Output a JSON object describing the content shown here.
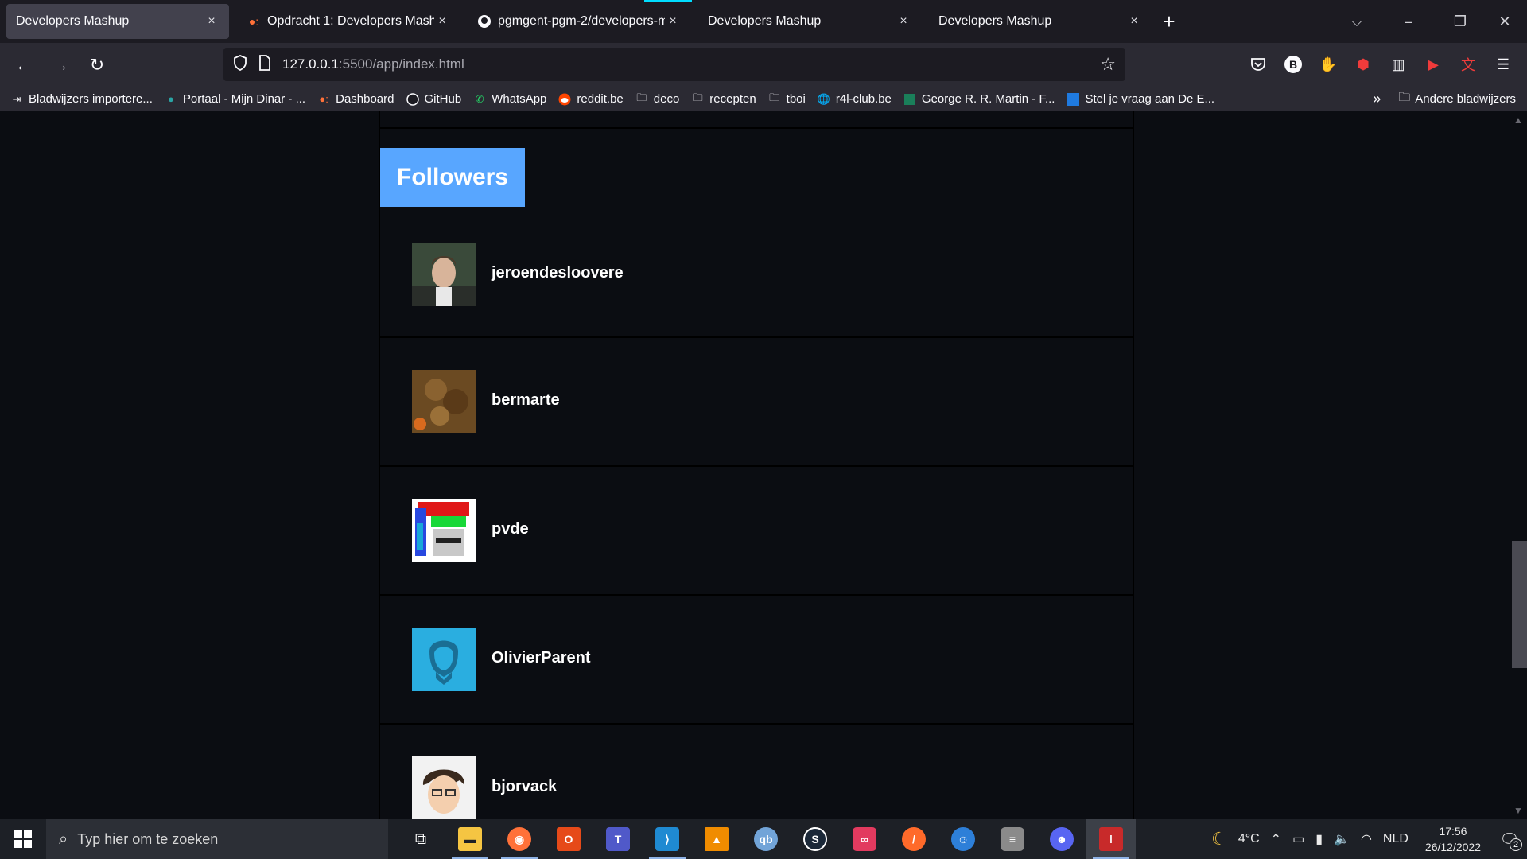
{
  "browser": {
    "tabs": [
      {
        "title": "Developers Mashup",
        "icon": "page-icon",
        "active": true
      },
      {
        "title": "Opdracht 1: Developers Mashup",
        "icon": "orange-dots-icon",
        "active": false
      },
      {
        "title": "pgmgent-pgm-2/developers-m",
        "icon": "github-icon",
        "active": false
      },
      {
        "title": "Developers Mashup",
        "icon": "page-icon",
        "active": false
      },
      {
        "title": "Developers Mashup",
        "icon": "page-icon",
        "active": false
      }
    ],
    "close_glyph": "×",
    "new_tab_glyph": "+",
    "list_tabs_glyph": "⌵",
    "window_controls": {
      "minimize": "–",
      "restore": "❐",
      "close": "✕"
    },
    "nav": {
      "back": "←",
      "forward": "→",
      "reload": "↻"
    },
    "url": {
      "host": "127.0.0.1",
      "path": ":5500/app/index.html"
    },
    "bookmarks": [
      {
        "label": "Bladwijzers importere...",
        "icon": "import-icon"
      },
      {
        "label": "Portaal - Mijn Dinar - ...",
        "icon": "sharepoint-icon"
      },
      {
        "label": "Dashboard",
        "icon": "orange-dots-icon"
      },
      {
        "label": "GitHub",
        "icon": "github-icon"
      },
      {
        "label": "WhatsApp",
        "icon": "whatsapp-icon"
      },
      {
        "label": "reddit.be",
        "icon": "reddit-icon"
      },
      {
        "label": "deco",
        "icon": "folder-icon"
      },
      {
        "label": "recepten",
        "icon": "folder-icon"
      },
      {
        "label": "tboi",
        "icon": "folder-icon"
      },
      {
        "label": "r4l-club.be",
        "icon": "globe-icon"
      },
      {
        "label": "George R. R. Martin - F...",
        "icon": "green-bookmark-icon"
      },
      {
        "label": "Stel je vraag aan De E...",
        "icon": "blue-bookmark-icon"
      }
    ],
    "other_bookmarks": "Andere bladwijzers"
  },
  "page": {
    "section_title": "Followers",
    "followers": [
      {
        "username": "jeroendesloovere",
        "avatar": "photo-avatar"
      },
      {
        "username": "bermarte",
        "avatar": "textured-avatar"
      },
      {
        "username": "pvde",
        "avatar": "pixel-avatar"
      },
      {
        "username": "OlivierParent",
        "avatar": "silhouette-avatar"
      },
      {
        "username": "bjorvack",
        "avatar": "cartoon-avatar"
      }
    ]
  },
  "taskbar": {
    "search_placeholder": "Typ hier om te zoeken",
    "weather": "4°C",
    "language": "NLD",
    "time": "17:56",
    "date": "26/12/2022",
    "notifications": "2"
  },
  "colors": {
    "accent": "#58a6ff",
    "page_bg": "#0b0d12"
  }
}
